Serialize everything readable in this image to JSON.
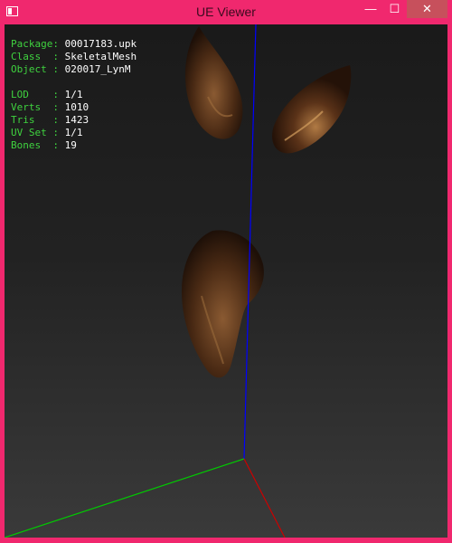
{
  "window": {
    "title": "UE Viewer"
  },
  "controls": {
    "minimize": "—",
    "maximize": "☐",
    "close": "✕"
  },
  "info": {
    "package_label": "Package:",
    "package_value": "00017183.upk",
    "class_label": "Class  :",
    "class_value": "SkeletalMesh",
    "object_label": "Object :",
    "object_value": "020017_LynM",
    "lod_label": "LOD    :",
    "lod_value": "1/1",
    "verts_label": "Verts  :",
    "verts_value": "1010",
    "tris_label": "Tris   :",
    "tris_value": "1423",
    "uvset_label": "UV Set :",
    "uvset_value": "1/1",
    "bones_label": "Bones  :",
    "bones_value": "19"
  },
  "colors": {
    "frame": "#f0286e",
    "label": "#3fd23f",
    "value": "#ffffff",
    "axis_x": "#cc0000",
    "axis_y": "#00cc00",
    "axis_z": "#0000ff"
  },
  "icons": {
    "app": "app-window-icon"
  }
}
